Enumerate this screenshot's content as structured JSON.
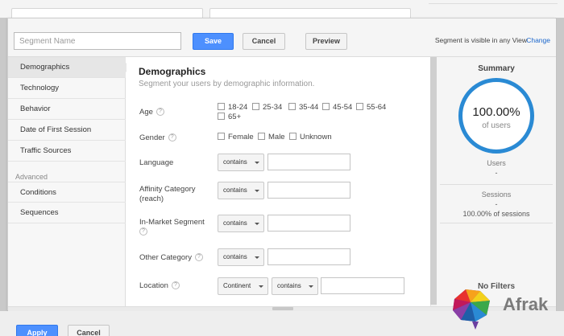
{
  "header": {
    "segment_name_placeholder": "Segment Name",
    "save_label": "Save",
    "cancel_label": "Cancel",
    "preview_label": "Preview",
    "visibility_text": "Segment is visible in any View",
    "change_label": "Change"
  },
  "sidebar": {
    "items": [
      {
        "label": "Demographics"
      },
      {
        "label": "Technology"
      },
      {
        "label": "Behavior"
      },
      {
        "label": "Date of First Session"
      },
      {
        "label": "Traffic Sources"
      }
    ],
    "advanced_label": "Advanced",
    "advanced_items": [
      {
        "label": "Conditions"
      },
      {
        "label": "Sequences"
      }
    ]
  },
  "main": {
    "title": "Demographics",
    "subtitle": "Segment your users by demographic information.",
    "age": {
      "label": "Age",
      "options": [
        "18-24",
        "25-34",
        "35-44",
        "45-54",
        "55-64",
        "65+"
      ]
    },
    "gender": {
      "label": "Gender",
      "options": [
        "Female",
        "Male",
        "Unknown"
      ]
    },
    "language": {
      "label": "Language",
      "operator": "contains"
    },
    "affinity": {
      "label_line1": "Affinity Category",
      "label_line2": "(reach)",
      "operator": "contains"
    },
    "in_market": {
      "label": "In-Market Segment",
      "operator": "contains"
    },
    "other": {
      "label": "Other Category",
      "operator": "contains"
    },
    "location": {
      "label": "Location",
      "scope": "Continent",
      "operator": "contains"
    },
    "help_glyph": "?"
  },
  "summary": {
    "title": "Summary",
    "percent": "100.00%",
    "percent_sub": "of users",
    "users_label": "Users",
    "users_value": "-",
    "sessions_label": "Sessions",
    "sessions_value": "-",
    "sessions_percent": "100.00% of sessions",
    "no_filters": "No Filters",
    "accent_color": "#2a8ad4"
  },
  "footer": {
    "apply_label": "Apply",
    "cancel_label": "Cancel"
  },
  "watermark": {
    "text": "Afrak"
  }
}
